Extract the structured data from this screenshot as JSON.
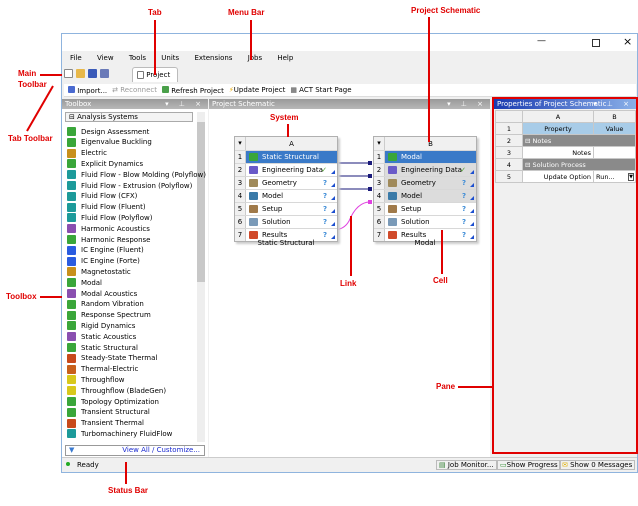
{
  "annotations": {
    "tab": "Tab",
    "menu_bar": "Menu Bar",
    "project_schematic": "Project Schematic",
    "main_toolbar": "Main\nToolbar",
    "tab_toolbar": "Tab Toolbar",
    "system": "System",
    "toolbox": "Toolbox",
    "link": "Link",
    "cell": "Cell",
    "pane": "Pane",
    "status_bar": "Status Bar"
  },
  "menu": [
    "File",
    "View",
    "Tools",
    "Units",
    "Extensions",
    "Jobs",
    "Help"
  ],
  "tab": {
    "label": "Project"
  },
  "tab_toolbar": {
    "import": "Import...",
    "reconnect": "Reconnect",
    "refresh": "Refresh Project",
    "update": "Update Project",
    "act": "ACT Start Page"
  },
  "toolbox": {
    "title": "Toolbox",
    "group": "Analysis Systems",
    "footer_link": "View All / Customize...",
    "items": [
      {
        "label": "Design Assessment",
        "color": "#3aa63a"
      },
      {
        "label": "Eigenvalue Buckling",
        "color": "#3aa63a"
      },
      {
        "label": "Electric",
        "color": "#c8901c"
      },
      {
        "label": "Explicit Dynamics",
        "color": "#3aa63a"
      },
      {
        "label": "Fluid Flow - Blow Molding (Polyflow)",
        "color": "#1c9a9a"
      },
      {
        "label": "Fluid Flow - Extrusion (Polyflow)",
        "color": "#1c9a9a"
      },
      {
        "label": "Fluid Flow (CFX)",
        "color": "#1c9a9a"
      },
      {
        "label": "Fluid Flow (Fluent)",
        "color": "#1c9a9a"
      },
      {
        "label": "Fluid Flow (Polyflow)",
        "color": "#1c9a9a"
      },
      {
        "label": "Harmonic Acoustics",
        "color": "#8a4fb0"
      },
      {
        "label": "Harmonic Response",
        "color": "#3aa63a"
      },
      {
        "label": "IC Engine (Fluent)",
        "color": "#2a5ce0"
      },
      {
        "label": "IC Engine (Forte)",
        "color": "#2a5ce0"
      },
      {
        "label": "Magnetostatic",
        "color": "#c8901c"
      },
      {
        "label": "Modal",
        "color": "#3aa63a"
      },
      {
        "label": "Modal Acoustics",
        "color": "#8a4fb0"
      },
      {
        "label": "Random Vibration",
        "color": "#3aa63a"
      },
      {
        "label": "Response Spectrum",
        "color": "#3aa63a"
      },
      {
        "label": "Rigid Dynamics",
        "color": "#3aa63a"
      },
      {
        "label": "Static Acoustics",
        "color": "#8a4fb0"
      },
      {
        "label": "Static Structural",
        "color": "#3aa63a"
      },
      {
        "label": "Steady-State Thermal",
        "color": "#c84a1c"
      },
      {
        "label": "Thermal-Electric",
        "color": "#c8601c"
      },
      {
        "label": "Throughflow",
        "color": "#d8c81c"
      },
      {
        "label": "Throughflow (BladeGen)",
        "color": "#d8c81c"
      },
      {
        "label": "Topology Optimization",
        "color": "#3aa63a"
      },
      {
        "label": "Transient Structural",
        "color": "#3aa63a"
      },
      {
        "label": "Transient Thermal",
        "color": "#c84a1c"
      },
      {
        "label": "Turbomachinery FluidFlow",
        "color": "#1c9a9a"
      }
    ]
  },
  "schematic": {
    "title": "Project Schematic",
    "systems": [
      {
        "letter": "A",
        "caption": "Static Structural",
        "rows": [
          {
            "n": "1",
            "label": "Static Structural",
            "status": ""
          },
          {
            "n": "2",
            "label": "Engineering Data",
            "status": "✓"
          },
          {
            "n": "3",
            "label": "Geometry",
            "status": "?"
          },
          {
            "n": "4",
            "label": "Model",
            "status": "?"
          },
          {
            "n": "5",
            "label": "Setup",
            "status": "?"
          },
          {
            "n": "6",
            "label": "Solution",
            "status": "?"
          },
          {
            "n": "7",
            "label": "Results",
            "status": "?"
          }
        ]
      },
      {
        "letter": "B",
        "caption": "Modal",
        "rows": [
          {
            "n": "1",
            "label": "Modal",
            "status": ""
          },
          {
            "n": "2",
            "label": "Engineering Data",
            "status": "✓"
          },
          {
            "n": "3",
            "label": "Geometry",
            "status": "?"
          },
          {
            "n": "4",
            "label": "Model",
            "status": "?"
          },
          {
            "n": "5",
            "label": "Setup",
            "status": "?"
          },
          {
            "n": "6",
            "label": "Solution",
            "status": "?"
          },
          {
            "n": "7",
            "label": "Results",
            "status": "?"
          }
        ]
      }
    ]
  },
  "properties": {
    "title": "Properties of Project Schematic",
    "col_a": "A",
    "col_b": "B",
    "rows": [
      {
        "n": "1",
        "a": "Property",
        "b": "Value"
      },
      {
        "n": "2",
        "a": "Notes",
        "b": ""
      },
      {
        "n": "3",
        "a": "Notes",
        "b": ""
      },
      {
        "n": "4",
        "a": "Solution Process",
        "b": ""
      },
      {
        "n": "5",
        "a": "Update Option",
        "b": "Run..."
      }
    ]
  },
  "status": {
    "text": "Ready",
    "job_monitor": "Job Monitor...",
    "show_progress": "Show Progress",
    "show_messages": "Show 0 Messages"
  }
}
